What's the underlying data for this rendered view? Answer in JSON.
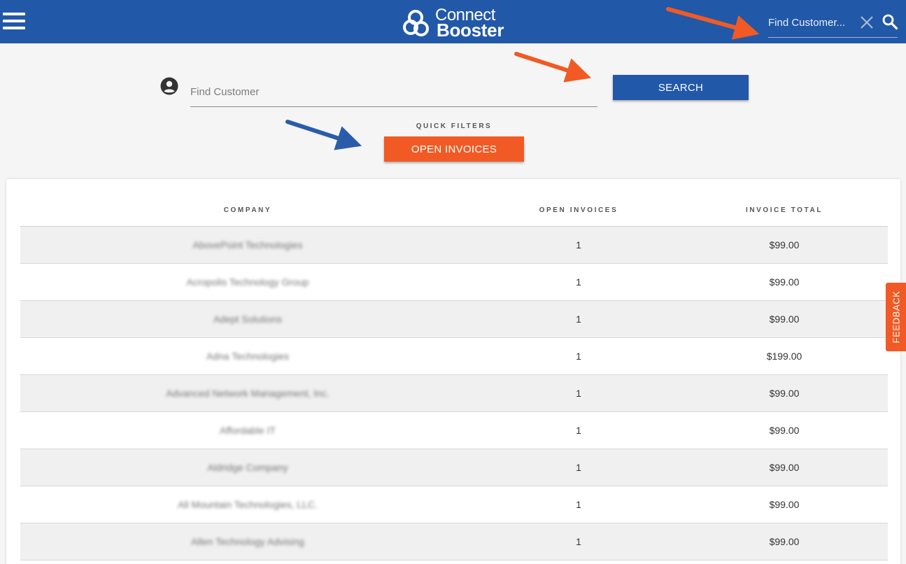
{
  "header": {
    "logo_line1": "Connect",
    "logo_line2": "Booster",
    "search_placeholder": "Find Customer..."
  },
  "search": {
    "placeholder": "Find Customer",
    "button_label": "SEARCH"
  },
  "quick_filters": {
    "label": "QUICK FILTERS",
    "open_invoices_label": "OPEN INVOICES"
  },
  "table": {
    "columns": [
      "COMPANY",
      "OPEN INVOICES",
      "INVOICE TOTAL"
    ],
    "rows": [
      {
        "company": "AbovePoint Technologies",
        "open_invoices": "1",
        "invoice_total": "$99.00"
      },
      {
        "company": "Acropolis Technology Group",
        "open_invoices": "1",
        "invoice_total": "$99.00"
      },
      {
        "company": "Adept Solutions",
        "open_invoices": "1",
        "invoice_total": "$99.00"
      },
      {
        "company": "Adna Technologies",
        "open_invoices": "1",
        "invoice_total": "$199.00"
      },
      {
        "company": "Advanced Network Management, Inc.",
        "open_invoices": "1",
        "invoice_total": "$99.00"
      },
      {
        "company": "Affordable IT",
        "open_invoices": "1",
        "invoice_total": "$99.00"
      },
      {
        "company": "Aldridge Company",
        "open_invoices": "1",
        "invoice_total": "$99.00"
      },
      {
        "company": "All Mountain Technologies, LLC.",
        "open_invoices": "1",
        "invoice_total": "$99.00"
      },
      {
        "company": "Allen Technology Advising",
        "open_invoices": "1",
        "invoice_total": "$99.00"
      }
    ]
  },
  "feedback_label": "FEEDBACK",
  "colors": {
    "brand_blue": "#2258a8",
    "accent_orange": "#f15a24",
    "annotation_blue": "#2a5caa",
    "annotation_orange": "#f15a24"
  },
  "icons": [
    "menu-icon",
    "logo-icon",
    "close-icon",
    "search-icon",
    "account-circle-icon"
  ]
}
